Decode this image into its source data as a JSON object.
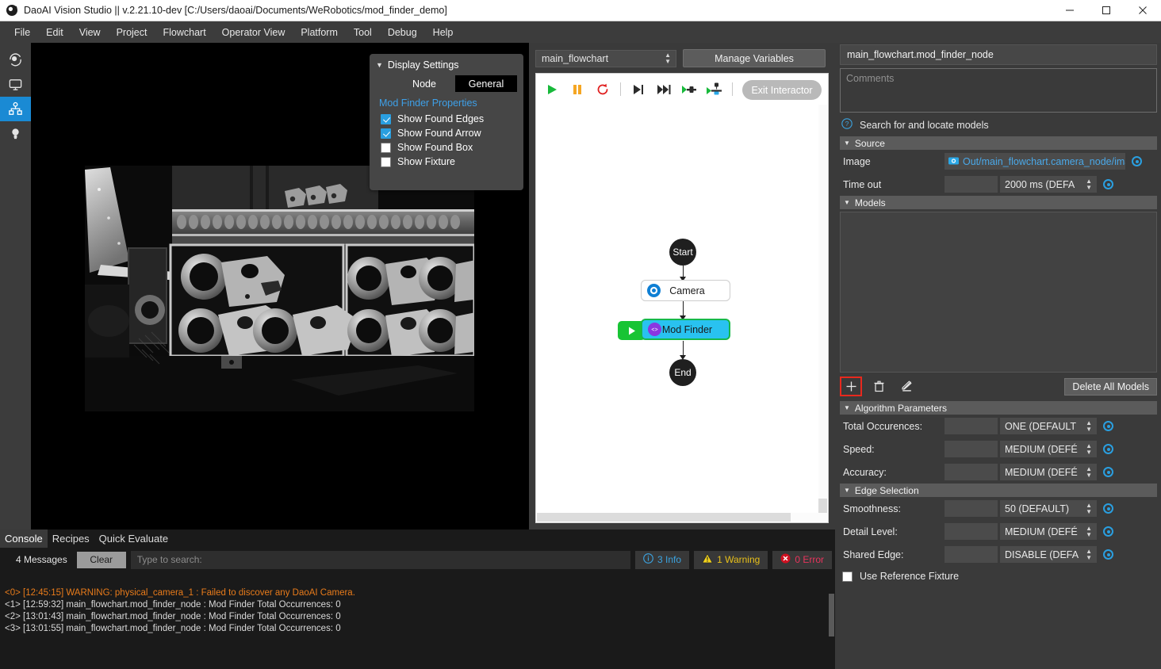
{
  "titlebar": {
    "title": "DaoAI Vision Studio || v.2.21.10-dev   [C:/Users/daoai/Documents/WeRobotics/mod_finder_demo]",
    "minimize": "—",
    "maximize": "☐",
    "close": "✕",
    "app_icon": "daoai-logo-icon"
  },
  "menubar": {
    "items": [
      {
        "label": "File"
      },
      {
        "label": "Edit"
      },
      {
        "label": "View"
      },
      {
        "label": "Project"
      },
      {
        "label": "Flowchart"
      },
      {
        "label": "Operator View"
      },
      {
        "label": "Platform"
      },
      {
        "label": "Tool"
      },
      {
        "label": "Debug"
      },
      {
        "label": "Help"
      }
    ]
  },
  "rail": {
    "items": [
      {
        "name": "vision-eye-icon",
        "active": false
      },
      {
        "name": "monitor-display-icon",
        "active": false
      },
      {
        "name": "flowchart-nodes-icon",
        "active": true
      },
      {
        "name": "lightbulb-icon",
        "active": false
      }
    ]
  },
  "display_settings": {
    "title": "Display Settings",
    "caret": "▼",
    "tabs": [
      {
        "label": "Node",
        "active": false
      },
      {
        "label": "General",
        "active": true
      }
    ],
    "subtitle": "Mod Finder Properties",
    "checkboxes": [
      {
        "label": "Show Found Edges",
        "checked": true
      },
      {
        "label": "Show Found Arrow",
        "checked": true
      },
      {
        "label": "Show Found Box",
        "checked": false
      },
      {
        "label": "Show Fixture",
        "checked": false
      }
    ]
  },
  "flowchart": {
    "selector_value": "main_flowchart",
    "manage_variables_label": "Manage Variables",
    "exit_interactor_label": "Exit Interactor",
    "run_controls": [
      {
        "name": "run-play-icon",
        "color": "#18b93b"
      },
      {
        "name": "pause-icon",
        "color": "#f5a623"
      },
      {
        "name": "restart-loop-icon",
        "color": "#e02020"
      },
      {
        "name": "step-over-icon",
        "color": "#2b2b2b"
      },
      {
        "name": "step-forward-icon",
        "color": "#2b2b2b"
      },
      {
        "name": "run-to-node-icon",
        "color": "#2b2b2b"
      },
      {
        "name": "run-from-node-icon",
        "color": "#2b2b2b"
      }
    ],
    "nodes": [
      {
        "id": "start",
        "label": "Start",
        "type": "terminal"
      },
      {
        "id": "camera",
        "label": "Camera",
        "type": "box",
        "icon": "camera-icon"
      },
      {
        "id": "mod_finder",
        "label": "Mod Finder",
        "type": "box",
        "icon": "mod-finder-icon",
        "selected": true
      },
      {
        "id": "end",
        "label": "End",
        "type": "terminal"
      }
    ]
  },
  "properties": {
    "node_title": "main_flowchart.mod_finder_node",
    "comments_placeholder": "Comments",
    "help_text": "Search for and locate models",
    "help_icon": "question-circle-icon",
    "sections": {
      "source": {
        "title": "Source",
        "rows": [
          {
            "label": "Image",
            "value": "Out/main_flowchart.camera_node/ima",
            "icon": "camera-small-icon",
            "kind": "link"
          },
          {
            "label": "Time out",
            "value": "2000 ms (DEFA",
            "kind": "combo"
          }
        ]
      },
      "models": {
        "title": "Models",
        "items": [],
        "toolbar": [
          {
            "name": "add-model-button",
            "glyph": "+",
            "selected": true
          },
          {
            "name": "delete-model-button",
            "glyph": "trash-icon",
            "selected": false
          },
          {
            "name": "edit-model-button",
            "glyph": "pencil-icon",
            "selected": false
          }
        ],
        "delete_all_label": "Delete All Models"
      },
      "algorithm_parameters": {
        "title": "Algorithm Parameters",
        "rows": [
          {
            "label": "Total Occurences:",
            "value": "ONE (DEFAULT"
          },
          {
            "label": "Speed:",
            "value": "MEDIUM (DEFÉ"
          },
          {
            "label": "Accuracy:",
            "value": "MEDIUM (DEFÉ"
          }
        ]
      },
      "edge_selection": {
        "title": "Edge Selection",
        "rows": [
          {
            "label": "Smoothness:",
            "value": "50 (DEFAULT)"
          },
          {
            "label": "Detail Level:",
            "value": "MEDIUM (DEFÉ"
          },
          {
            "label": "Shared Edge:",
            "value": "DISABLE (DEFA"
          }
        ],
        "fixture_checkbox": {
          "label": "Use Reference Fixture",
          "checked": false
        }
      }
    }
  },
  "console": {
    "tabs": [
      {
        "label": "Console",
        "active": true
      },
      {
        "label": "Recipes",
        "active": false
      },
      {
        "label": "Quick Evaluate",
        "active": false
      }
    ],
    "message_count": "4 Messages",
    "clear_label": "Clear",
    "search_placeholder": "Type to search:",
    "badges": [
      {
        "label": "3 Info",
        "icon": "info-circle-icon",
        "color": "#3ba3e0"
      },
      {
        "label": "1 Warning",
        "icon": "warning-triangle-icon",
        "color": "#e8c01a"
      },
      {
        "label": "0 Error",
        "icon": "error-circle-icon",
        "color": "#e8345c"
      }
    ],
    "log_lines": [
      {
        "text": "<0> [12:45:15] WARNING: physical_camera_1 : Failed to discover any DaoAI Camera.",
        "level": "warning"
      },
      {
        "text": "<1> [12:59:32] main_flowchart.mod_finder_node : Mod Finder Total Occurrences: 0",
        "level": "info"
      },
      {
        "text": "<2> [13:01:43] main_flowchart.mod_finder_node : Mod Finder Total Occurrences: 0",
        "level": "info"
      },
      {
        "text": "<3> [13:01:55] main_flowchart.mod_finder_node : Mod Finder Total Occurrences: 0",
        "level": "info"
      }
    ]
  },
  "colors": {
    "accent_blue": "#1a8ad4",
    "link_blue": "#4aa8e8",
    "selected_node": "#29c2f0",
    "node_border_green": "#17b84a",
    "highlight_red": "#e8291e",
    "warning_orange": "#e87b1a"
  }
}
